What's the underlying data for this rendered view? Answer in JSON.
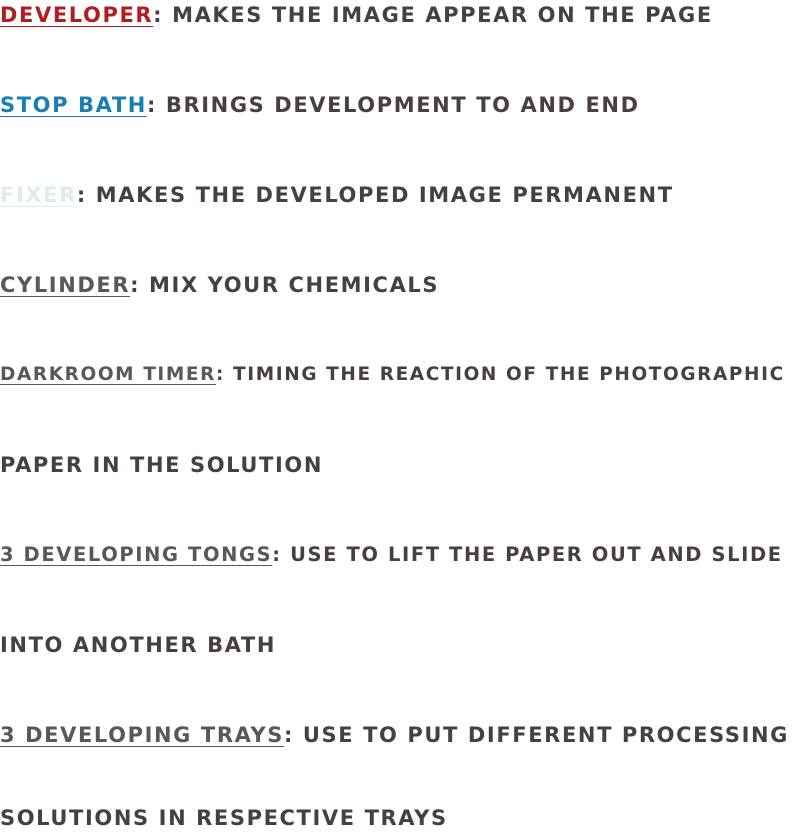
{
  "items": [
    {
      "term": "DEVELOPER",
      "sep": ":",
      "desc": " MAKES THE IMAGE APPEAR ON THE PAGE",
      "term_color": "#b11e22"
    },
    {
      "term": "STOP BATH",
      "sep": ":",
      "desc": " BRINGS DEVELOPMENT TO AND END",
      "term_color": "#1a7fb0"
    },
    {
      "term": "FIXER",
      "sep": ":",
      "desc": " MAKES THE DEVELOPED IMAGE PERMANENT",
      "term_color": "#ddeee5"
    },
    {
      "term": "CYLINDER",
      "sep": ":",
      "desc": " MIX YOUR CHEMICALS",
      "term_color": "#55595f"
    },
    {
      "term": "DARKROOM TIMER",
      "sep": ":",
      "desc": " TIMING THE REACTION OF THE PHOTOGRAPHIC",
      "term_color": "#55595f"
    },
    {
      "desc": "PAPER IN THE SOLUTION"
    },
    {
      "term": "3 DEVELOPING TONGS",
      "sep": ":",
      "desc": " USE TO LIFT THE PAPER OUT AND SLIDE",
      "term_color": "#55595f"
    },
    {
      "desc": "INTO ANOTHER BATH"
    },
    {
      "term": "3 DEVELOPING TRAYS",
      "sep": ":",
      "desc": " USE TO PUT DIFFERENT PROCESSING",
      "term_color": "#55595f"
    },
    {
      "desc": "SOLUTIONS IN RESPECTIVE TRAYS"
    }
  ],
  "text_color": "#4a3f3f"
}
